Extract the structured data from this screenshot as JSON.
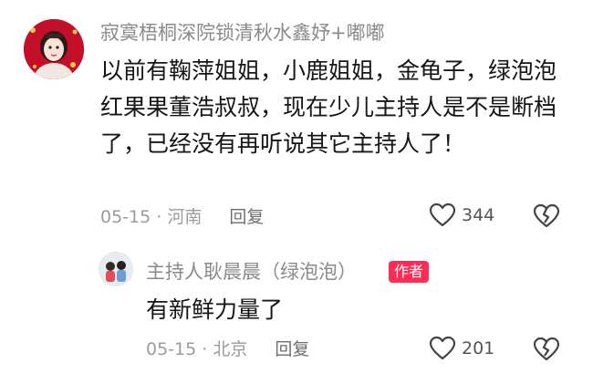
{
  "comments": [
    {
      "username": "寂寞梧桐深院锁清秋水鑫妤+嘟嘟",
      "text": "以前有鞠萍姐姐，小鹿姐姐，金龟子，绿泡泡红果果董浩叔叔，现在少儿主持人是不是断档了，已经没有再听说其它主持人了！",
      "date": "05-15",
      "location": "河南",
      "reply_label": "回复",
      "likes": "344",
      "like_icon": "heart-outline-icon",
      "dislike_icon": "broken-heart-icon"
    }
  ],
  "replies": [
    {
      "username": "主持人耿晨晨（绿泡泡）",
      "badge": "作者",
      "text": "有新鲜力量了",
      "date": "05-15",
      "location": "北京",
      "reply_label": "回复",
      "likes": "201",
      "like_icon": "heart-outline-icon",
      "dislike_icon": "broken-heart-icon"
    }
  ],
  "colors": {
    "badge": "#fe2c55",
    "username": "#8a8a8a",
    "text": "#161616",
    "meta": "#9b9b9b"
  }
}
